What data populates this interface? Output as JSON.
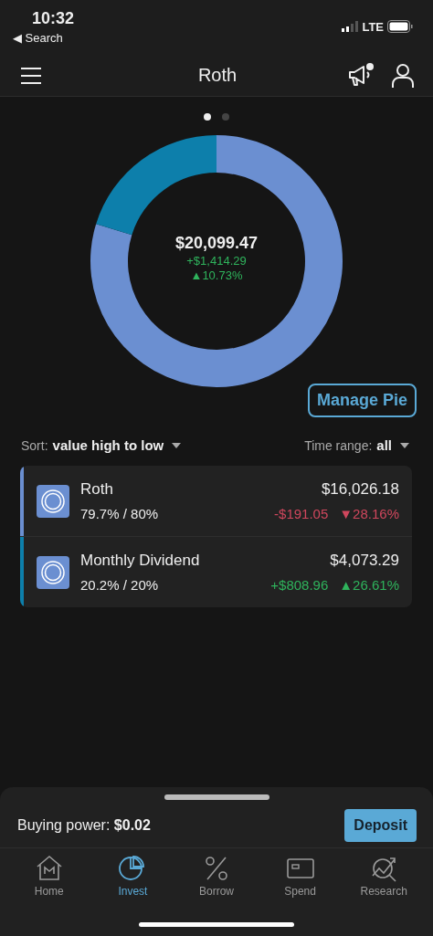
{
  "status_bar": {
    "time": "10:32",
    "back_link": "◀ Search",
    "network": "LTE"
  },
  "header": {
    "title": "Roth",
    "notification": true
  },
  "pager": [
    {
      "selected": true
    },
    {
      "selected": false
    }
  ],
  "pie": {
    "total": "$20,099.47",
    "gain": "+$1,414.29",
    "gain_percent": "▲10.73%",
    "negative": false,
    "chart_data": {
      "type": "donut",
      "values": [
        79.7,
        20.2
      ]
    }
  },
  "manage_button": "Manage Pie",
  "sort": {
    "label": "Sort:",
    "value": "value high to low"
  },
  "time_range": {
    "label": "Time range:",
    "value": "all"
  },
  "holdings": [
    {
      "name": "Roth",
      "allocation": "79.7% / 80%",
      "value": "$16,026.18",
      "change": "-$191.05",
      "change_percent": "▼28.16%",
      "negative": true,
      "color": "#6b8fd1"
    },
    {
      "name": "Monthly Dividend",
      "allocation": "20.2% / 20%",
      "value": "$4,073.29",
      "change": "+$808.96",
      "change_percent": "▲26.61%",
      "negative": false,
      "color": "#0d7fab"
    }
  ],
  "buying_power": {
    "label": "Buying power:",
    "value": "$0.02"
  },
  "deposit_button": "Deposit",
  "tabs": [
    {
      "label": "Home",
      "kind": "home",
      "selected": false
    },
    {
      "label": "Invest",
      "kind": "invest",
      "selected": true
    },
    {
      "label": "Borrow",
      "kind": "borrow",
      "selected": false
    },
    {
      "label": "Spend",
      "kind": "spend",
      "selected": false
    },
    {
      "label": "Research",
      "kind": "research",
      "selected": false
    }
  ]
}
